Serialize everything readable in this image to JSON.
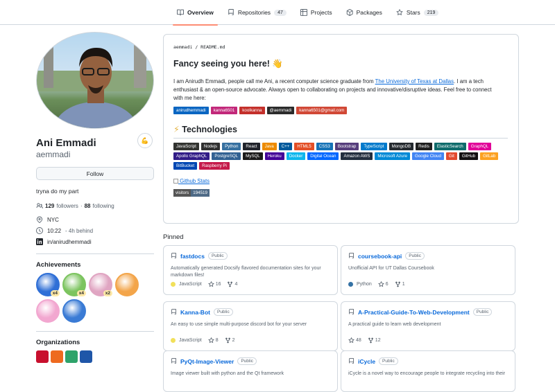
{
  "nav": {
    "tabs": [
      {
        "label": "Overview",
        "icon": "book-icon",
        "active": true
      },
      {
        "label": "Repositories",
        "icon": "repo-icon",
        "count": "47"
      },
      {
        "label": "Projects",
        "icon": "table-icon"
      },
      {
        "label": "Packages",
        "icon": "package-icon"
      },
      {
        "label": "Stars",
        "icon": "star-icon",
        "count": "219"
      }
    ]
  },
  "profile": {
    "status_emoji": "💪",
    "full_name": "Ani Emmadi",
    "login": "aemmadi",
    "follow_label": "Follow",
    "bio": "tryna do my part",
    "followers_count": "129",
    "followers_label": "followers",
    "following_count": "88",
    "following_label": "following",
    "location": "NYC",
    "time": "10:22",
    "time_note": "- 4h behind",
    "linkedin": "in/anirudhemmadi"
  },
  "achievements": {
    "title": "Achievements",
    "items": [
      {
        "name": "pull-shark",
        "count": "x4",
        "color": "#2f6fd6"
      },
      {
        "name": "pair-extraordinaire",
        "count": "x4",
        "color": "#7cc45f"
      },
      {
        "name": "galaxy-brain",
        "count": "x2",
        "color": "#e0a5c2"
      },
      {
        "name": "starstruck",
        "count": "",
        "color": "#f3a54a"
      },
      {
        "name": "yolo",
        "count": "",
        "color": "#f2a7d0"
      },
      {
        "name": "arctic-code-vault",
        "count": "",
        "color": "#3a7bd5"
      }
    ]
  },
  "organizations": {
    "title": "Organizations",
    "colors": [
      "#c8102e",
      "#ee6a1f",
      "#2ea36a",
      "#1f56a8"
    ]
  },
  "readme": {
    "path_owner": "aemmadi",
    "path_sep": "/",
    "path_file": "README.md",
    "heading": "Fancy seeing you here!",
    "heading_emoji": "👋",
    "intro_before": "I am Anirudh Emmadi, people call me Ani, a recent computer science graduate from ",
    "intro_link": "The University of Texas at Dallas",
    "intro_after": ". I am a tech enthusiast & an open-source advocate. Always open to collaborating on projects and innovative/disruptive ideas. Feel free to connect with me here:",
    "socials": [
      {
        "label": "anirudhemmadi",
        "color": "#0a66c2"
      },
      {
        "label": "kanna6501",
        "color": "#c2287a"
      },
      {
        "label": "koolkanna",
        "color": "#c4302b"
      },
      {
        "label": "@aemmadi",
        "color": "#2b2b2b"
      },
      {
        "label": "kanna6501@gmail.com",
        "color": "#d14836"
      }
    ],
    "tech_heading_emoji": "⚡",
    "tech_heading": "Technologies",
    "techs": [
      {
        "label": "JavaScript",
        "color": "#323330"
      },
      {
        "label": "Nodejs",
        "color": "#303030"
      },
      {
        "label": "Python",
        "color": "#3670a0"
      },
      {
        "label": "React",
        "color": "#20232a"
      },
      {
        "label": "Java",
        "color": "#ed8b00"
      },
      {
        "label": "C++",
        "color": "#00599c"
      },
      {
        "label": "HTML5",
        "color": "#e34f26"
      },
      {
        "label": "CSS3",
        "color": "#1572b6"
      },
      {
        "label": "Bootstrap",
        "color": "#563d7c"
      },
      {
        "label": "TypeScript",
        "color": "#007acc"
      },
      {
        "label": "MongoDB",
        "color": "#24292e"
      },
      {
        "label": "Redis",
        "color": "#1f1f1f"
      },
      {
        "label": "ElasticSearch",
        "color": "#0e6b6b"
      },
      {
        "label": "GraphQL",
        "color": "#e10098"
      },
      {
        "label": "Apollo GraphQL",
        "color": "#311c87"
      },
      {
        "label": "PostgreSQL",
        "color": "#316192"
      },
      {
        "label": "MySQL",
        "color": "#1a1a1a"
      },
      {
        "label": "Heroku",
        "color": "#430098"
      },
      {
        "label": "Docker",
        "color": "#0db7ed"
      },
      {
        "label": "Digital Ocean",
        "color": "#0167ff"
      },
      {
        "label": "Amazon AWS",
        "color": "#232f3e"
      },
      {
        "label": "Microsoft Azure",
        "color": "#0089d6"
      },
      {
        "label": "Google Cloud",
        "color": "#4285f4"
      },
      {
        "label": "Git",
        "color": "#e24a2e"
      },
      {
        "label": "GitHub",
        "color": "#121011"
      },
      {
        "label": "GitLab",
        "color": "#fca121"
      },
      {
        "label": "BitBucket",
        "color": "#0047b3"
      },
      {
        "label": "Raspberry Pi",
        "color": "#c51a4a"
      }
    ],
    "stats_alt": "Github Stats",
    "visitors_label": "visitors",
    "visitors_count": "194519"
  },
  "pinned": {
    "title": "Pinned",
    "repos": [
      {
        "name": "fastdocs",
        "visibility": "Public",
        "desc": "Automatically generated Docsify flavored documentation sites for your markdown files!",
        "lang": "JavaScript",
        "lang_color": "#f1e05a",
        "stars": "16",
        "forks": "4"
      },
      {
        "name": "coursebook-api",
        "visibility": "Public",
        "desc": "Unofficial API for UT Dallas Coursebook",
        "lang": "Python",
        "lang_color": "#3572a5",
        "stars": "6",
        "forks": "1"
      },
      {
        "name": "Kanna-Bot",
        "visibility": "Public",
        "desc": "An easy to use simple multi-purpose discord bot for your server",
        "lang": "JavaScript",
        "lang_color": "#f1e05a",
        "stars": "8",
        "forks": "2"
      },
      {
        "name": "A-Practical-Guide-To-Web-Development",
        "visibility": "Public",
        "desc": "A practical guide to learn web development",
        "lang": "",
        "lang_color": "",
        "stars": "48",
        "forks": "12"
      },
      {
        "name": "PyQt-Image-Viewer",
        "visibility": "Public",
        "desc": "Image viewer built with python and the Qt framework",
        "lang": "",
        "lang_color": "",
        "stars": "",
        "forks": ""
      },
      {
        "name": "iCycle",
        "visibility": "Public",
        "desc": "iCycle is a novel way to encourage people to integrate recycling into their",
        "lang": "",
        "lang_color": "",
        "stars": "",
        "forks": ""
      }
    ]
  }
}
